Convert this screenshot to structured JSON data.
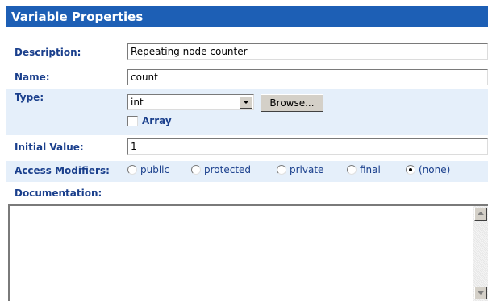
{
  "title": "Variable Properties",
  "description": {
    "label": "Description:",
    "value": "Repeating node counter"
  },
  "name": {
    "label": "Name:",
    "value": "count"
  },
  "type": {
    "label": "Type:",
    "value": "int",
    "browse_label": "Browse...",
    "array_label": "Array",
    "array_checked": false
  },
  "initial_value": {
    "label": "Initial Value:",
    "value": "1"
  },
  "access_modifiers": {
    "label": "Access Modifiers:",
    "options": [
      "public",
      "protected",
      "private",
      "final",
      "(none)"
    ],
    "selected": "(none)"
  },
  "documentation": {
    "label": "Documentation:",
    "value": ""
  }
}
